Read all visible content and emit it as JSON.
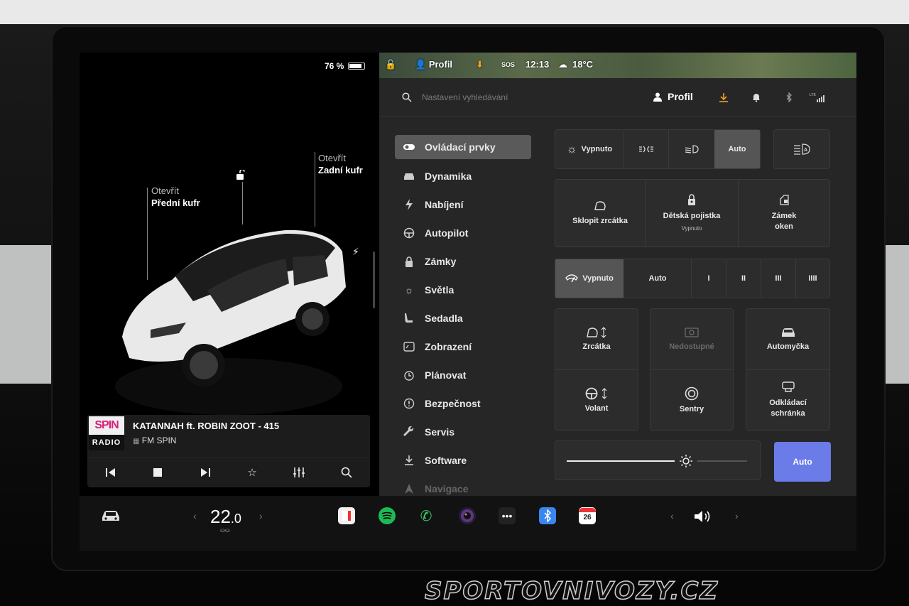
{
  "status": {
    "battery": "76 %",
    "battery_fraction": 0.76
  },
  "map_bar": {
    "profile": "Profil",
    "sos": "SOS",
    "time": "12:13",
    "temperature": "18°C"
  },
  "car": {
    "front_trunk": {
      "action": "Otevřít",
      "name": "Přední kufr"
    },
    "rear_trunk": {
      "action": "Otevřít",
      "name": "Zadní kufr"
    }
  },
  "media": {
    "logo_top": "SPIN",
    "logo_bottom": "RADIO",
    "track": "KATANNAH ft. ROBIN ZOOT - 415",
    "station": "FM SPIN"
  },
  "settings": {
    "search_placeholder": "Nastavení vyhledávání",
    "profile": "Profil",
    "menu": [
      {
        "label": "Ovládací prvky",
        "icon": "toggle-icon"
      },
      {
        "label": "Dynamika",
        "icon": "car-icon"
      },
      {
        "label": "Nabíjení",
        "icon": "bolt-icon"
      },
      {
        "label": "Autopilot",
        "icon": "steering-wheel-icon"
      },
      {
        "label": "Zámky",
        "icon": "lock-icon"
      },
      {
        "label": "Světla",
        "icon": "sun-icon"
      },
      {
        "label": "Sedadla",
        "icon": "seat-icon"
      },
      {
        "label": "Zobrazení",
        "icon": "display-icon"
      },
      {
        "label": "Plánovat",
        "icon": "alarm-icon"
      },
      {
        "label": "Bezpečnost",
        "icon": "alert-icon"
      },
      {
        "label": "Servis",
        "icon": "wrench-icon"
      },
      {
        "label": "Software",
        "icon": "download-icon"
      },
      {
        "label": "Navigace",
        "icon": "navigation-icon"
      }
    ],
    "lights": {
      "off": "Vypnuto",
      "auto": "Auto"
    },
    "row2": {
      "mirrors_fold": "Sklopit zrcátka",
      "child_lock": "Dětská pojistka",
      "child_lock_state": "Vypnuto",
      "window_lock_1": "Zámek",
      "window_lock_2": "oken"
    },
    "wipers": {
      "off": "Vypnuto",
      "auto": "Auto",
      "levels": [
        "I",
        "II",
        "III",
        "IIII"
      ]
    },
    "tiles": {
      "mirrors": "Zrcátka",
      "unavailable": "Nedostupné",
      "carwash": "Automyčka",
      "steering": "Volant",
      "sentry": "Sentry",
      "glovebox_1": "Odkládací",
      "glovebox_2": "schránka"
    },
    "brightness": {
      "auto_label": "Auto",
      "level": 0.6
    }
  },
  "bottom": {
    "temp_whole": "22",
    "temp_decimal": ".0",
    "calendar_day": "26"
  },
  "watermark": "SPORTOVNIVOZY.CZ",
  "colors": {
    "accent": "#6b7be8",
    "active_menu": "#5a5a5a",
    "spotify": "#1db954",
    "phone": "#3ecf6a",
    "bluetooth": "#3a86f0"
  }
}
